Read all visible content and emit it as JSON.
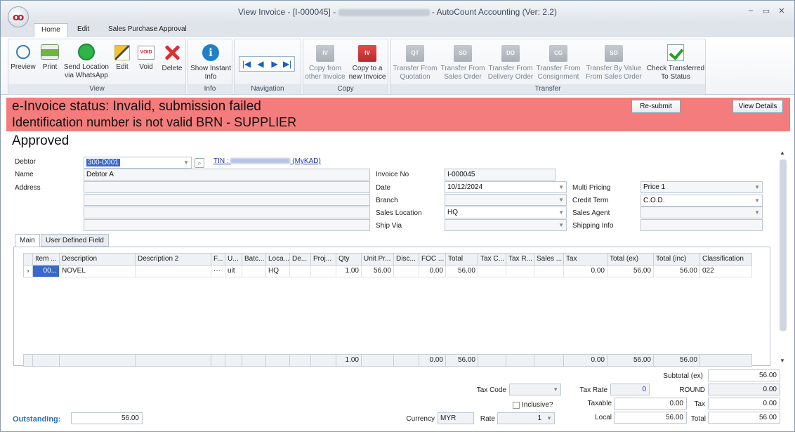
{
  "window": {
    "title_prefix": "View Invoice - [I-000045] - ",
    "company_blurred": "AUTO COUNT SDN BHD",
    "title_suffix": " - AutoCount Accounting (Ver: 2.2)",
    "logo_text": "oo"
  },
  "menu_tabs": [
    "Home",
    "Edit",
    "Sales Purchase Approval"
  ],
  "ribbon": {
    "groups": {
      "view": "View",
      "info": "Info",
      "navigation": "Navigation",
      "copy": "Copy",
      "transfer": "Transfer"
    },
    "buttons": {
      "preview": "Preview",
      "print": "Print",
      "send_whatsapp": "Send Location via WhatsApp",
      "edit": "Edit",
      "void": "Void",
      "delete": "Delete",
      "show_instant_info": "Show Instant Info",
      "copy_from_other": "Copy from other Invoice",
      "copy_to_new": "Copy to a new Invoice",
      "transfer_quotation": "Transfer From Quotation",
      "transfer_sales_order": "Transfer From Sales Order",
      "transfer_delivery_order": "Transfer From Delivery Order",
      "transfer_consignment": "Transfer From Consignment",
      "transfer_by_value": "Transfer By Value From Sales Order",
      "check_transferred": "Check Transferred To Status"
    },
    "icon_text": {
      "void": "VOID",
      "iv": "IV",
      "qt": "QT",
      "so": "SO",
      "do": "DO",
      "cg": "CG"
    }
  },
  "banner": {
    "status": "e-Invoice status: Invalid, submission failed",
    "message": "Identification number is not valid BRN - SUPPLIER",
    "resubmit": "Re-submit",
    "view_details": "View Details",
    "color": "#f47c7c"
  },
  "approval_status": "Approved",
  "form": {
    "debtor_label": "Debtor",
    "debtor_value": "300-D001",
    "tin_label": "TIN :",
    "tin_suffix": "(MyKAD)",
    "name_label": "Name",
    "name_value": "Debtor A",
    "address_label": "Address",
    "invoice_no_label": "Invoice No",
    "invoice_no_value": "I-000045",
    "date_label": "Date",
    "date_value": "10/12/2024",
    "branch_label": "Branch",
    "sales_location_label": "Sales Location",
    "sales_location_value": "HQ",
    "ship_via_label": "Ship Via",
    "multi_pricing_label": "Multi Pricing",
    "multi_pricing_value": "Price 1",
    "credit_term_label": "Credit Term",
    "credit_term_value": "C.O.D.",
    "sales_agent_label": "Sales Agent",
    "shipping_info_label": "Shipping Info"
  },
  "detail_tabs": [
    "Main",
    "User Defined Field"
  ],
  "grid": {
    "columns": [
      "Item ...",
      "Description",
      "Description 2",
      "F...",
      "U...",
      "Batc...",
      "Loca...",
      "De...",
      "Proj...",
      "Qty",
      "Unit Pr...",
      "Disc...",
      "FOC ...",
      "Total",
      "Tax C...",
      "Tax R...",
      "Sales ...",
      "Tax",
      "Total (ex)",
      "Total (inc)",
      "Classification"
    ],
    "rows": [
      [
        "00...",
        "NOVEL",
        "",
        "···",
        "uit",
        "",
        "HQ",
        "",
        "",
        "1.00",
        "56.00",
        "",
        "0.00",
        "56.00",
        "",
        "",
        "",
        "0.00",
        "56.00",
        "56.00",
        "022"
      ]
    ],
    "footer": {
      "qty": "1.00",
      "foc": "0.00",
      "total": "56.00",
      "tax": "0.00",
      "total_ex": "56.00",
      "total_inc": "56.00"
    }
  },
  "totals": {
    "subtotal_label": "Subtotal (ex)",
    "subtotal_value": "56.00",
    "tax_code_label": "Tax Code",
    "tax_rate_label": "Tax Rate",
    "tax_rate_value": "0",
    "round_label": "ROUND",
    "round_value": "0.00",
    "inclusive_label": "Inclusive?",
    "taxable_label": "Taxable",
    "taxable_value": "0.00",
    "tax_label": "Tax",
    "tax_value": "0.00",
    "outstanding_label": "Outstanding:",
    "outstanding_value": "56.00",
    "currency_label": "Currency",
    "currency_value": "MYR",
    "rate_label": "Rate",
    "rate_value": "1",
    "local_label": "Local",
    "local_value": "56.00",
    "total_label": "Total",
    "total_value": "56.00"
  }
}
